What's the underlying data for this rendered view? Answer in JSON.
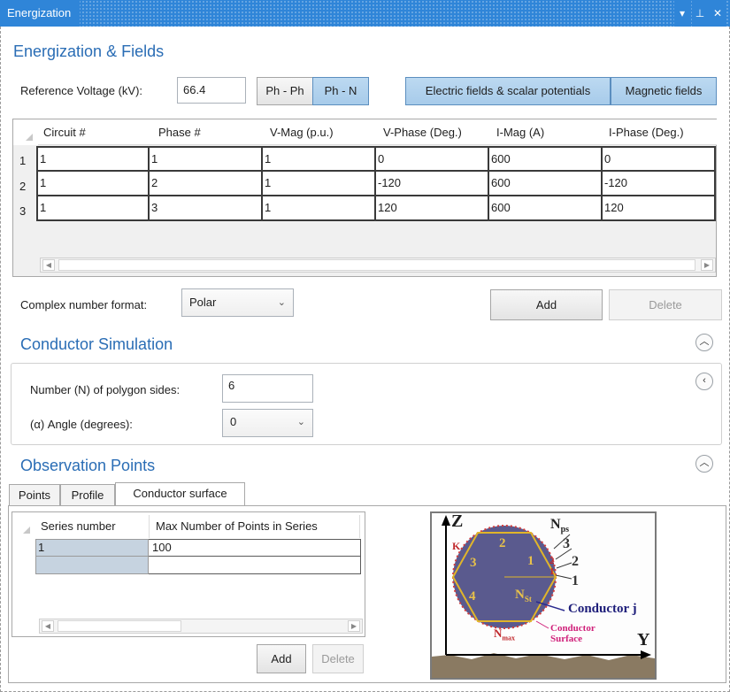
{
  "window": {
    "title": "Energization",
    "controls": [
      "▾",
      "⊥",
      "✕"
    ]
  },
  "energization": {
    "title": "Energization & Fields",
    "ref_voltage_label": "Reference Voltage (kV):",
    "ref_voltage_value": "66.4",
    "ph_ph_label": "Ph - Ph",
    "ph_n_label": "Ph - N",
    "electric_fields_label": "Electric fields & scalar potentials",
    "magnetic_fields_label": "Magnetic fields",
    "table": {
      "columns": [
        "Circuit #",
        "Phase #",
        "V-Mag (p.u.)",
        "V-Phase (Deg.)",
        "I-Mag (A)",
        "I-Phase (Deg.)"
      ],
      "rows": [
        {
          "index": "1",
          "cells": [
            "1",
            "1",
            "1",
            "0",
            "600",
            "0"
          ]
        },
        {
          "index": "2",
          "cells": [
            "1",
            "2",
            "1",
            "-120",
            "600",
            "-120"
          ]
        },
        {
          "index": "3",
          "cells": [
            "1",
            "3",
            "1",
            "120",
            "600",
            "120"
          ]
        }
      ]
    },
    "complex_format_label": "Complex number format:",
    "complex_format_value": "Polar",
    "add_label": "Add",
    "delete_label": "Delete"
  },
  "conductor": {
    "title": "Conductor Simulation",
    "sides_label": "Number (N) of polygon sides:",
    "sides_value": "6",
    "angle_label": "(α) Angle (degrees):",
    "angle_value": "0"
  },
  "observation": {
    "title": "Observation Points",
    "tabs": [
      "Points",
      "Profile",
      "Conductor surface"
    ],
    "table": {
      "columns": [
        "Series number",
        "Max Number of Points in Series"
      ],
      "rows": [
        {
          "cells": [
            "1",
            "100"
          ]
        },
        {
          "cells": [
            "",
            ""
          ]
        }
      ]
    },
    "add_label": "Add",
    "delete_label": "Delete",
    "diagram": {
      "axis_z": "Z",
      "axis_y": "Y",
      "k_label": "K",
      "n_ps": "N",
      "n_ps_sub": "ps",
      "n_st": "N",
      "n_st_sub": "St",
      "n_max": "N",
      "n_max_sub": "max",
      "seg_labels": [
        "1",
        "2",
        "3",
        "4"
      ],
      "point_labels": [
        "3",
        "2",
        "1"
      ],
      "small_labels": [
        "2",
        "1"
      ],
      "conductor_label": "Conductor j",
      "surface_label_1": "Conductor",
      "surface_label_2": "Surface"
    }
  },
  "icons": {
    "collapse": "chevron-up-icon",
    "expand_left": "chevron-left-icon",
    "dropdown": "chevron-down-icon"
  }
}
